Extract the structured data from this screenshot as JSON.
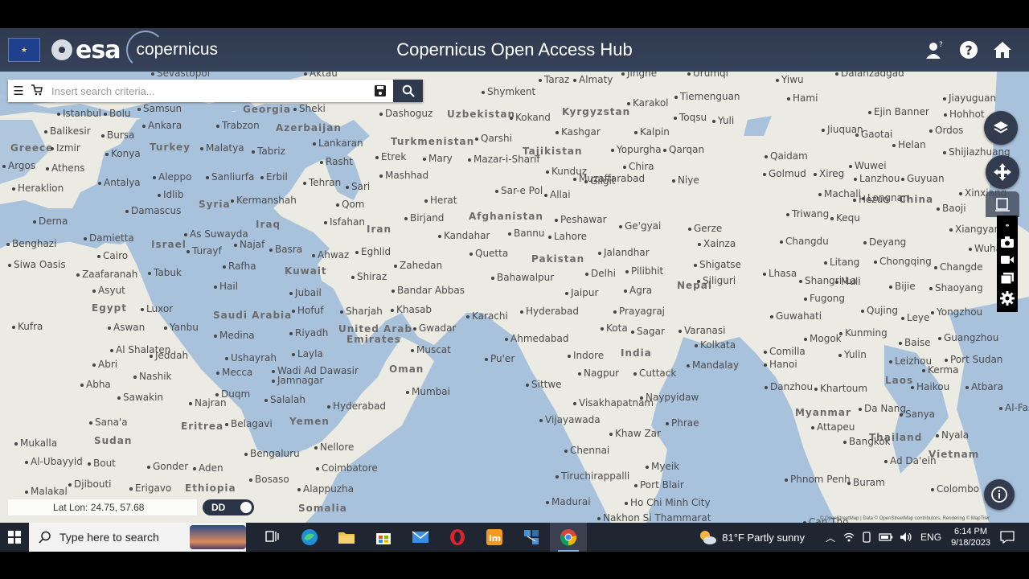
{
  "header": {
    "title": "Copernicus Open Access Hub",
    "esa_text": "esa",
    "copernicus_text": "opernicus",
    "copernicus_c": "c",
    "eu_text": "★"
  },
  "search": {
    "placeholder": "Insert search criteria..."
  },
  "map": {
    "countries": [
      "Georgia",
      "Azerbaijan",
      "Uzbekistan",
      "Kyrgyzstan",
      "Turkey",
      "Turkmenistan",
      "Tajikistan",
      "Greece",
      "Syria",
      "Iraq",
      "Afghanistan",
      "Iran",
      "Israel",
      "Kuwait",
      "Pakistan",
      "Nepal",
      "China",
      "Egypt",
      "Saudi Arabia",
      "United Arab",
      "Emirates",
      "India",
      "Oman",
      "Sudan",
      "Eritrea",
      "Yemen",
      "Ethiopia",
      "Somalia",
      "Myanmar",
      "Laos",
      "Thailand",
      "Vietnam"
    ],
    "cities": [
      "Taraz",
      "Almaty",
      "Jinghe",
      "Urumqi",
      "Yiwu",
      "Dalanzadgad",
      "Sevastopol",
      "Aktau",
      "Shymkent",
      "Tiemenguan",
      "Hami",
      "Jiayuguan",
      "Istanbul",
      "Bolu",
      "Samsun",
      "Sheki",
      "Dashoguz",
      "Karakol",
      "Ejin Banner",
      "Hohhot",
      "Bursa",
      "Ankara",
      "Trabzon",
      "Kokand",
      "Toqsu",
      "Yuli",
      "Balikesir",
      "Lankaran",
      "Qarshi",
      "Kashgar",
      "Kalpin",
      "Jiuquan",
      "Gaotai",
      "Ordos",
      "Izmir",
      "Konya",
      "Malatya",
      "Tabriz",
      "Yopurgha",
      "Qarqan",
      "Helan",
      "Shijiazhuang",
      "Argos",
      "Athens",
      "Rasht",
      "Etrek",
      "Mary",
      "Mazar-i-Sharif",
      "Kunduz",
      "Chira",
      "Qaidam",
      "Wuwei",
      "Golmud",
      "Xireg",
      "Lanzhou",
      "Guyuan",
      "Heraklion",
      "Antalya",
      "Aleppo",
      "Sanliurfa",
      "Erbil",
      "Tehran",
      "Mashhad",
      "Gilgit",
      "Niye",
      "Idlib",
      "Sari",
      "Sar-e Pol",
      "Allai",
      "Muzaffarabad",
      "Machali",
      "Hezuo",
      "Xinxiang",
      "Kermanshah",
      "Qom",
      "Herat",
      "Peshawar",
      "Longnan",
      "Baoji",
      "Damascus",
      "Birjand",
      "Ge'gyai",
      "Triwang",
      "Kequ",
      "Derna",
      "As Suwayda",
      "Isfahan",
      "Kandahar",
      "Bannu",
      "Lahore",
      "Gerze",
      "Xiangyang",
      "Benghazi",
      "Damietta",
      "Najaf",
      "Basra",
      "Quetta",
      "Jalandhar",
      "Changdu",
      "Deyang",
      "Cairo",
      "Turayf",
      "Ahwaz",
      "Eghlid",
      "Xainza",
      "Wuhan",
      "Siwa Oasis",
      "Zaafaranah",
      "Tabuk",
      "Rafha",
      "Zahedan",
      "Delhi",
      "Pilibhit",
      "Shigatse",
      "Litang",
      "Chongqing",
      "Changde",
      "Asyut",
      "Hail",
      "Jubail",
      "Shiraz",
      "Bahawalpur",
      "Lhasa",
      "Bijie",
      "Shangri-La",
      "Muli",
      "Shaoyang",
      "Bandar Abbas",
      "Jaipur",
      "Agra",
      "Siliguri",
      "Fugong",
      "Yongzhou",
      "Luxor",
      "Hofuf",
      "Sharjah",
      "Khasab",
      "Karachi",
      "Hyderabad",
      "Prayagraj",
      "Qujing",
      "Leye",
      "Kufra",
      "Aswan",
      "Yanbu",
      "Riyadh",
      "Gwadar",
      "Kota",
      "Sagar",
      "Varanasi",
      "Guwahati",
      "Medina",
      "Layla",
      "Ahmedabad",
      "Kunming",
      "Baise",
      "Guangzhou",
      "Al Shalaten",
      "Jeddah",
      "Ushayrah",
      "Muscat",
      "Indore",
      "Kolkata",
      "Mogok",
      "Comilla",
      "Abri",
      "Mecca",
      "Wadi Ad Dawasir",
      "Jamnagar",
      "Pu'er",
      "Yulin",
      "Port Sudan",
      "Nashik",
      "Nagpur",
      "Cuttack",
      "Mandalay",
      "Hanoi",
      "Leizhou",
      "Kerma",
      "Abha",
      "Duqm",
      "Mumbai",
      "Sittwe",
      "Danzhou",
      "Haikou",
      "Atbara",
      "Sawakin",
      "Najran",
      "Salalah",
      "Hyderabad",
      "Visakhapatnam",
      "Naypyidaw",
      "Khartoum",
      "Sana'a",
      "Belagavi",
      "Vijayawada",
      "Phrae",
      "Da Nang",
      "Sanya",
      "Al-Fashir",
      "Mukalla",
      "Nellore",
      "Khaw Zar",
      "Attapeu",
      "Nyala",
      "Al-Ubayyid",
      "Bout",
      "Gonder",
      "Aden",
      "Bengaluru",
      "Chennai",
      "Myeik",
      "Bangkok",
      "Ad Da'ein",
      "Djibouti",
      "Bosaso",
      "Coimbatore",
      "Tiruchirappalli",
      "Port Blair",
      "Phnom Penh",
      "Buram",
      "Malakal",
      "Erigavo",
      "Alappuzha",
      "Madurai",
      "Ho Chi Minh City",
      "Colombo",
      "Nakhon Si Thammarat",
      "Can Tho"
    ]
  },
  "latlon": {
    "label": "Lat Lon: 24.75, 57.68"
  },
  "toggle": {
    "label": "DD"
  },
  "attribution": "© OpenStreetMap | Data © OpenStreetMap contributors, Rendering © MapTiler",
  "taskbar": {
    "search_text": "Type here to search",
    "weather": "81°F  Partly sunny",
    "language": "ENG",
    "time": "6:14 PM",
    "date": "9/18/2023"
  },
  "colors": {
    "header": "#2f3a4f",
    "map_water": "#a9c2dc",
    "map_land": "#ecebe3",
    "button": "#333c4e"
  }
}
